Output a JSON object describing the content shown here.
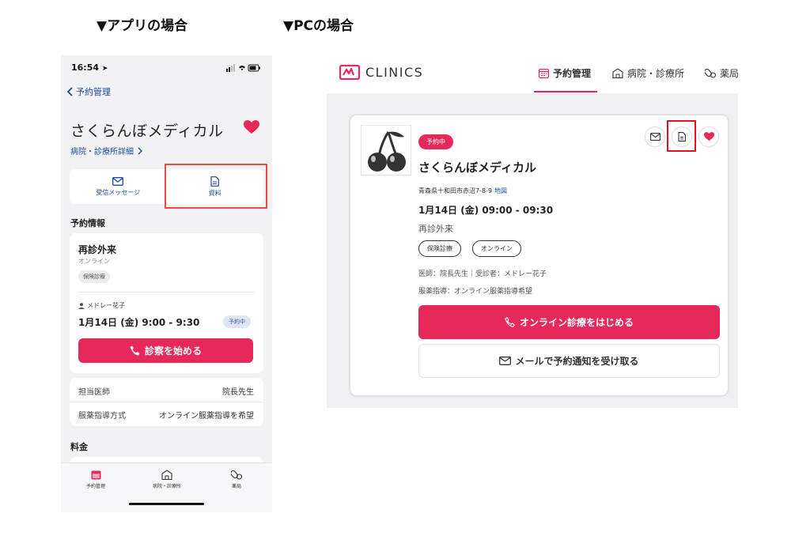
{
  "headings": {
    "app": "▼アプリの場合",
    "pc": "▼PCの場合"
  },
  "app": {
    "status_time": "16:54",
    "back_label": "予約管理",
    "clinic_name": "さくらんぼメディカル",
    "detail_link": "病院・診療所詳細",
    "tabs": [
      {
        "label": "受信メッセージ",
        "icon": "mail-icon"
      },
      {
        "label": "資料",
        "icon": "document-icon"
      }
    ],
    "reservation_heading": "予約情報",
    "visit_type": "再診外来",
    "visit_mode": "オンライン",
    "insurance_tag": "保険診療",
    "patient": "メドレー花子",
    "datetime": "1月14日 (金) 9:00 - 9:30",
    "status_badge": "予約中",
    "start_button": "診察を始める",
    "details": [
      {
        "label": "担当医師",
        "value": "院長先生"
      },
      {
        "label": "服薬指導方式",
        "value": "オンライン服薬指導を希望"
      }
    ],
    "fee_heading": "料金",
    "bottom_nav": [
      {
        "label": "予約管理",
        "icon": "calendar-icon"
      },
      {
        "label": "病院・診療所",
        "icon": "hospital-icon"
      },
      {
        "label": "薬局",
        "icon": "pill-icon"
      }
    ],
    "colors": {
      "accent": "#e6285a",
      "link": "#1b4a9b"
    }
  },
  "pc": {
    "logo_text": "CLINICS",
    "nav": [
      {
        "label": "予約管理",
        "icon": "calendar-icon",
        "active": true
      },
      {
        "label": "病院・診療所",
        "icon": "hospital-icon",
        "active": false
      },
      {
        "label": "薬局",
        "icon": "pill-icon",
        "active": false
      }
    ],
    "status_badge": "予約中",
    "clinic_name": "さくらんぼメディカル",
    "address": "青森県十和田市赤沼7-8-9",
    "map_link": "地図",
    "datetime": "1月14日 (金) 09:00 - 09:30",
    "visit_type": "再診外来",
    "tags": [
      "保険診療",
      "オンライン"
    ],
    "doctor_line": "医師：院長先生｜受診者：メドレー花子",
    "pharmacy_line": "服薬指導：オンライン服薬指導希望",
    "start_button": "オンライン診療をはじめる",
    "notify_button": "メールで予約通知を受け取る",
    "colors": {
      "accent": "#e6285a",
      "highlight_box": "#e0121f"
    }
  }
}
